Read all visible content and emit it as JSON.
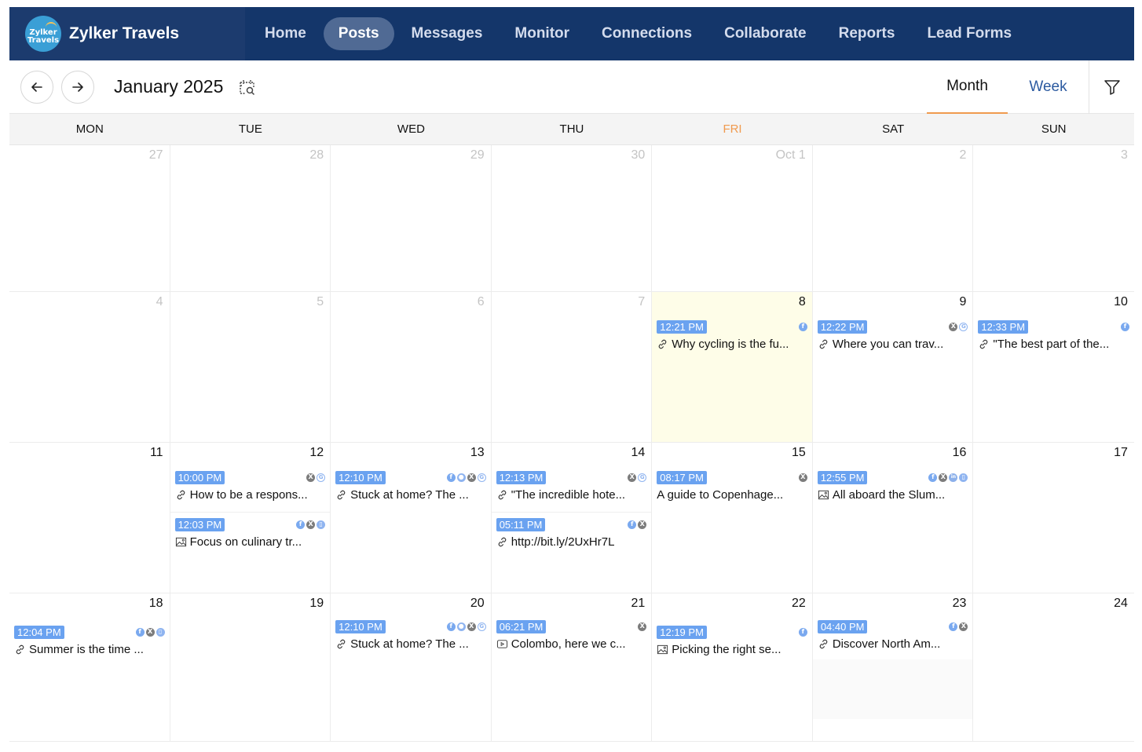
{
  "brand": {
    "name": "Zylker Travels",
    "logo_text_line1": "Zylker",
    "logo_text_line2": "Travels"
  },
  "nav": [
    {
      "label": "Home",
      "active": false
    },
    {
      "label": "Posts",
      "active": true
    },
    {
      "label": "Messages",
      "active": false
    },
    {
      "label": "Monitor",
      "active": false
    },
    {
      "label": "Connections",
      "active": false
    },
    {
      "label": "Collaborate",
      "active": false
    },
    {
      "label": "Reports",
      "active": false
    },
    {
      "label": "Lead Forms",
      "active": false
    }
  ],
  "toolbar": {
    "prev_icon": "arrow-left-icon",
    "next_icon": "arrow-right-icon",
    "month_title": "January 2025",
    "calendar_search_icon": "calendar-search-icon",
    "views": [
      {
        "label": "Month",
        "active": true
      },
      {
        "label": "Week",
        "active": false
      }
    ],
    "filter_icon": "filter-icon"
  },
  "colors": {
    "nav_bg": "#14366a",
    "accent": "#f09a4e",
    "time_badge": "#6aa2f0",
    "today_bg": "#fefde8",
    "week_tab": "#2c5aa0"
  },
  "weekdays": [
    {
      "label": "MON",
      "today": false
    },
    {
      "label": "TUE",
      "today": false
    },
    {
      "label": "WED",
      "today": false
    },
    {
      "label": "THU",
      "today": false
    },
    {
      "label": "FRI",
      "today": true
    },
    {
      "label": "SAT",
      "today": false
    },
    {
      "label": "SUN",
      "today": false
    }
  ],
  "weeks": [
    {
      "days": [
        {
          "num": "27",
          "other": true,
          "posts": []
        },
        {
          "num": "28",
          "other": true,
          "posts": []
        },
        {
          "num": "29",
          "other": true,
          "posts": []
        },
        {
          "num": "30",
          "other": true,
          "posts": []
        },
        {
          "num": "Oct 1",
          "other": true,
          "posts": []
        },
        {
          "num": "2",
          "other": true,
          "posts": []
        },
        {
          "num": "3",
          "other": true,
          "posts": []
        }
      ]
    },
    {
      "days": [
        {
          "num": "4",
          "other": true,
          "posts": []
        },
        {
          "num": "5",
          "other": true,
          "posts": []
        },
        {
          "num": "6",
          "other": true,
          "posts": []
        },
        {
          "num": "7",
          "other": true,
          "posts": []
        },
        {
          "num": "8",
          "other": false,
          "highlight": true,
          "posts": [
            {
              "time": "12:21 PM",
              "type": "link",
              "title": "Why cycling is the fu...",
              "networks": [
                "facebook"
              ]
            }
          ]
        },
        {
          "num": "9",
          "other": false,
          "posts": [
            {
              "time": "12:22 PM",
              "type": "link",
              "title": "Where you can trav...",
              "networks": [
                "x",
                "google"
              ]
            }
          ]
        },
        {
          "num": "10",
          "other": false,
          "posts": [
            {
              "time": "12:33 PM",
              "type": "link",
              "title": "\"The best part of the...",
              "networks": [
                "facebook"
              ]
            }
          ]
        }
      ]
    },
    {
      "days": [
        {
          "num": "11",
          "other": false,
          "posts": []
        },
        {
          "num": "12",
          "other": false,
          "posts": [
            {
              "time": "10:00 PM",
              "type": "link",
              "title": "How to be a respons...",
              "networks": [
                "x",
                "google"
              ]
            },
            {
              "time": "12:03 PM",
              "type": "image",
              "title": "Focus on culinary tr...",
              "networks": [
                "facebook",
                "x",
                "bookmark"
              ]
            }
          ]
        },
        {
          "num": "13",
          "other": false,
          "posts": [
            {
              "time": "12:10 PM",
              "type": "link",
              "title": "Stuck at home? The ...",
              "networks": [
                "facebook",
                "group",
                "x",
                "google"
              ]
            }
          ]
        },
        {
          "num": "14",
          "other": false,
          "posts": [
            {
              "time": "12:13 PM",
              "type": "link",
              "title": "\"The incredible hote...",
              "networks": [
                "x",
                "google"
              ]
            },
            {
              "time": "05:11 PM",
              "type": "link",
              "title": "http://bit.ly/2UxHr7L",
              "networks": [
                "facebook",
                "x"
              ]
            }
          ]
        },
        {
          "num": "15",
          "other": false,
          "posts": [
            {
              "time": "08:17 PM",
              "type": "text",
              "title": "A guide to Copenhage...",
              "networks": [
                "x"
              ]
            }
          ]
        },
        {
          "num": "16",
          "other": false,
          "posts": [
            {
              "time": "12:55 PM",
              "type": "image",
              "title": "All aboard the Slum...",
              "networks": [
                "facebook",
                "x",
                "linkedin",
                "bookmark"
              ]
            }
          ]
        },
        {
          "num": "17",
          "other": false,
          "posts": []
        }
      ]
    },
    {
      "days": [
        {
          "num": "18",
          "other": false,
          "posts": [
            {
              "time": "12:04 PM",
              "type": "link",
              "title": "Summer is the time ...",
              "networks": [
                "facebook",
                "x",
                "bookmark"
              ]
            }
          ]
        },
        {
          "num": "19",
          "other": false,
          "posts": []
        },
        {
          "num": "20",
          "other": false,
          "posts": [
            {
              "time": "12:10 PM",
              "type": "link",
              "title": "Stuck at home? The ...",
              "networks": [
                "facebook",
                "group",
                "x",
                "google"
              ]
            }
          ]
        },
        {
          "num": "21",
          "other": false,
          "posts": [
            {
              "time": "06:21 PM",
              "type": "video",
              "title": "Colombo, here we c...",
              "networks": [
                "x"
              ]
            }
          ]
        },
        {
          "num": "22",
          "other": false,
          "posts": [
            {
              "time": "12:19 PM",
              "type": "image",
              "title": "Picking the right se...",
              "networks": [
                "facebook"
              ]
            }
          ]
        },
        {
          "num": "23",
          "other": false,
          "gray": true,
          "posts": [
            {
              "time": "04:40 PM",
              "type": "link",
              "title": "Discover North Am...",
              "networks": [
                "facebook",
                "x"
              ]
            }
          ]
        },
        {
          "num": "24",
          "other": false,
          "posts": []
        }
      ]
    }
  ]
}
